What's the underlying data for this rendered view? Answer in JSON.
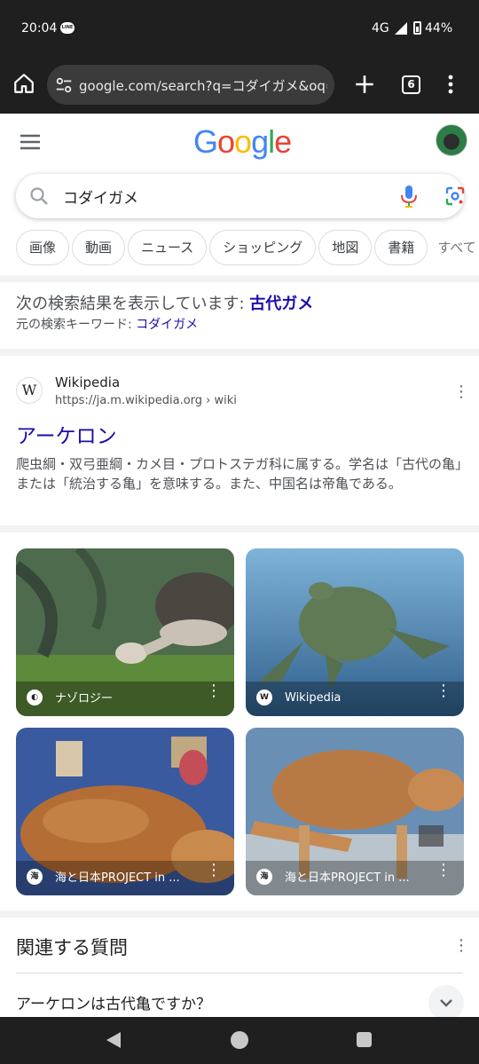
{
  "status_bar": {
    "time": "20:04",
    "notification": "LINE",
    "network": "4G",
    "battery": "44%"
  },
  "browser": {
    "url": "google.com/search?q=コダイガメ&oq=コ",
    "tab_count": "6"
  },
  "google": {
    "logo": "Google",
    "query": "コダイガメ",
    "chips": [
      "画像",
      "動画",
      "ニュース",
      "ショッピング",
      "地図",
      "書籍",
      "すべて"
    ]
  },
  "spelling": {
    "prefix": "次の検索結果を表示しています: ",
    "corrected": "古代ガメ",
    "original_prefix": "元の検索キーワード: ",
    "original": "コダイガメ"
  },
  "result": {
    "site_name": "Wikipedia",
    "url": "https://ja.m.wikipedia.org › wiki",
    "favicon": "W",
    "title": "アーケロン",
    "snippet": "爬虫綱・双弓亜綱・カメ目・プロトステガ科に属する。学名は「古代の亀」または「統治する亀」を意味する。また、中国名は帝亀である。"
  },
  "images": [
    {
      "source": "ナゾロジー",
      "icon_text": "◐"
    },
    {
      "source": "Wikipedia",
      "icon_text": "W"
    },
    {
      "source": "海と日本PROJECT in ...",
      "icon_text": "海"
    },
    {
      "source": "海と日本PROJECT in ...",
      "icon_text": "海"
    }
  ],
  "related": {
    "title": "関連する質問",
    "question": "アーケロンは古代亀ですか？"
  }
}
